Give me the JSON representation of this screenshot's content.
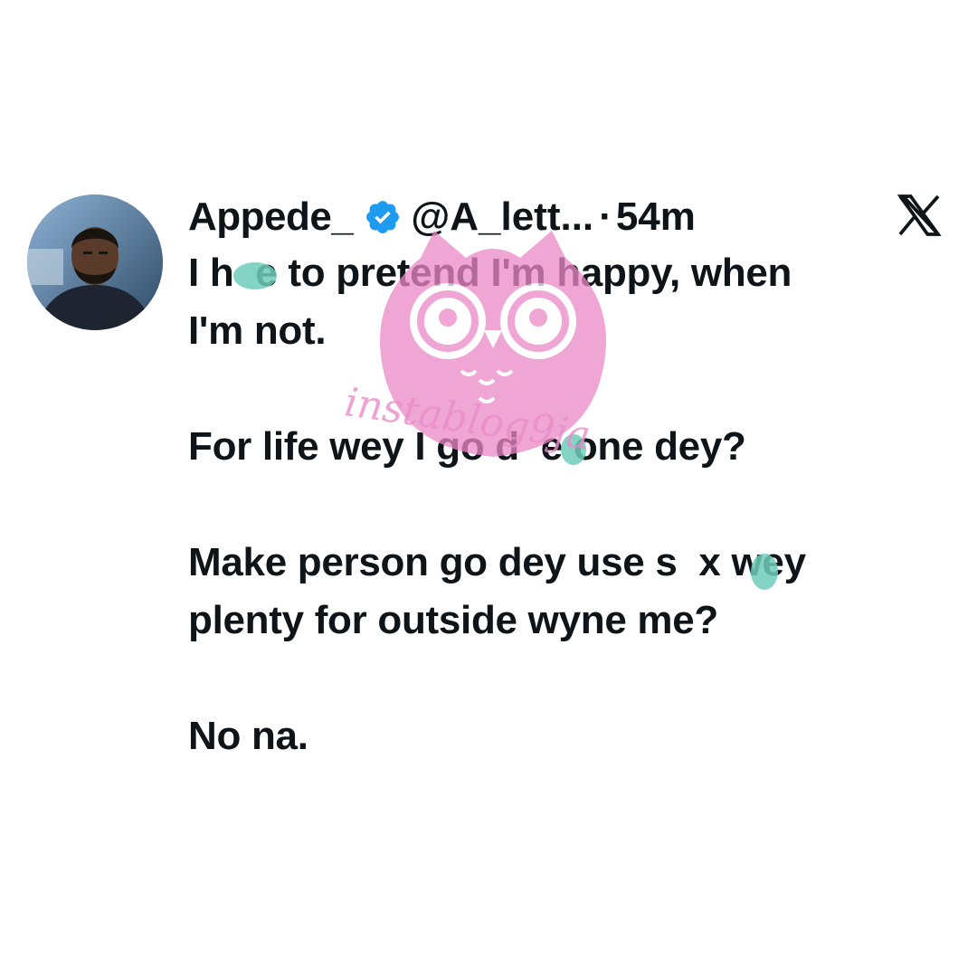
{
  "tweet": {
    "display_name": "Appede_",
    "handle": "@A_lett...",
    "separator": "·",
    "time": "54m",
    "paragraphs": [
      "I h  e to pretend I'm happy, when\nI'm not.",
      "For life wey I go d  e one dey?",
      "Make person go dey use s  x wey\nplenty for outside wyne me?",
      "No na."
    ]
  },
  "watermark": {
    "text": "instablog9ja"
  },
  "colors": {
    "verified": "#1d9bf0",
    "text": "#0f1419",
    "censor_mark": "#6fcdbb",
    "watermark": "#e98ec9"
  },
  "icons": {
    "verified": "verified-badge-icon",
    "platform": "x-logo-icon"
  }
}
